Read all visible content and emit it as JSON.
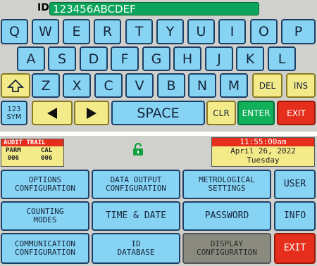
{
  "id_field": {
    "label": "ID:",
    "value": "123456ABCDEF"
  },
  "keyboard": {
    "row1": [
      "Q",
      "W",
      "E",
      "R",
      "T",
      "Y",
      "U",
      "I",
      "O",
      "P"
    ],
    "row2": [
      "A",
      "S",
      "D",
      "F",
      "G",
      "H",
      "J",
      "K",
      "L"
    ],
    "row3": [
      "Z",
      "X",
      "C",
      "V",
      "B",
      "N",
      "M"
    ],
    "shift_icon": "up-arrow-outline",
    "del": "DEL",
    "ins": "INS",
    "sym": "123\nSYM",
    "left_icon": "left-triangle",
    "right_icon": "right-triangle",
    "space": "SPACE",
    "clr": "CLR",
    "enter": "ENTER",
    "exit": "EXIT"
  },
  "status": {
    "audit_title": "AUDIT TRAIL",
    "parm_label": "PARM",
    "parm_value": "006",
    "cal_label": "CAL",
    "cal_value": "006",
    "lock_icon": "unlocked",
    "time": "11:55:00am",
    "date": "April 26, 2022",
    "weekday": "Tuesday"
  },
  "menu": {
    "options": "OPTIONS\nCONFIGURATION",
    "data_output": "DATA OUTPUT\nCONFIGURATION",
    "metrological": "METROLOGICAL\nSETTINGS",
    "user": "USER",
    "counting": "COUNTING\nMODES",
    "time_date": "TIME & DATE",
    "password": "PASSWORD",
    "info": "INFO",
    "communication": "COMMUNICATION\nCONFIGURATION",
    "id_database": "ID\nDATABASE",
    "display": "DISPLAY\nCONFIGURATION",
    "exit": "EXIT"
  },
  "colors": {
    "key_blue": "#86d3f3",
    "key_yellow": "#f3ea8a",
    "enter_green": "#11b05a",
    "exit_red": "#e52f1c",
    "id_field_green": "#0aa55a"
  }
}
